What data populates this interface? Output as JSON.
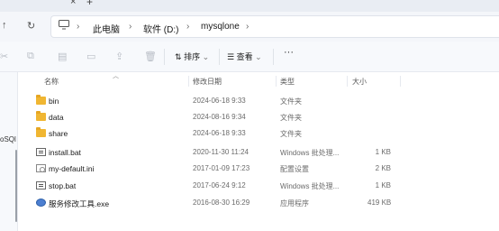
{
  "tabstrip": {
    "close": "×",
    "new_tab": "+"
  },
  "nav": {
    "up": "↑",
    "refresh": "↻",
    "crumbs": [
      "此电脑",
      "软件 (D:)",
      "mysqlone"
    ],
    "sep": "›"
  },
  "toolbar": {
    "sort": "排序",
    "view": "查看",
    "more": "···",
    "caret": "⌄"
  },
  "sidebar": {
    "text": "oSQl"
  },
  "columns": {
    "name": "名称",
    "date": "修改日期",
    "type": "类型",
    "size": "大小"
  },
  "files": [
    {
      "icon": "folder",
      "name": "bin",
      "date": "2024-06-18 9:33",
      "type": "文件夹",
      "size": ""
    },
    {
      "icon": "folder",
      "name": "data",
      "date": "2024-08-16 9:34",
      "type": "文件夹",
      "size": ""
    },
    {
      "icon": "folder",
      "name": "share",
      "date": "2024-06-18 9:33",
      "type": "文件夹",
      "size": ""
    },
    {
      "icon": "bat",
      "name": "install.bat",
      "date": "2020-11-30 11:24",
      "type": "Windows 批处理...",
      "size": "1 KB"
    },
    {
      "icon": "ini",
      "name": "my-default.ini",
      "date": "2017-01-09 17:23",
      "type": "配置设置",
      "size": "2 KB"
    },
    {
      "icon": "bat",
      "name": "stop.bat",
      "date": "2017-06-24 9:12",
      "type": "Windows 批处理...",
      "size": "1 KB"
    },
    {
      "icon": "exe",
      "name": "服务修改工具.exe",
      "date": "2016-08-30 16:29",
      "type": "应用程序",
      "size": "419 KB"
    }
  ]
}
